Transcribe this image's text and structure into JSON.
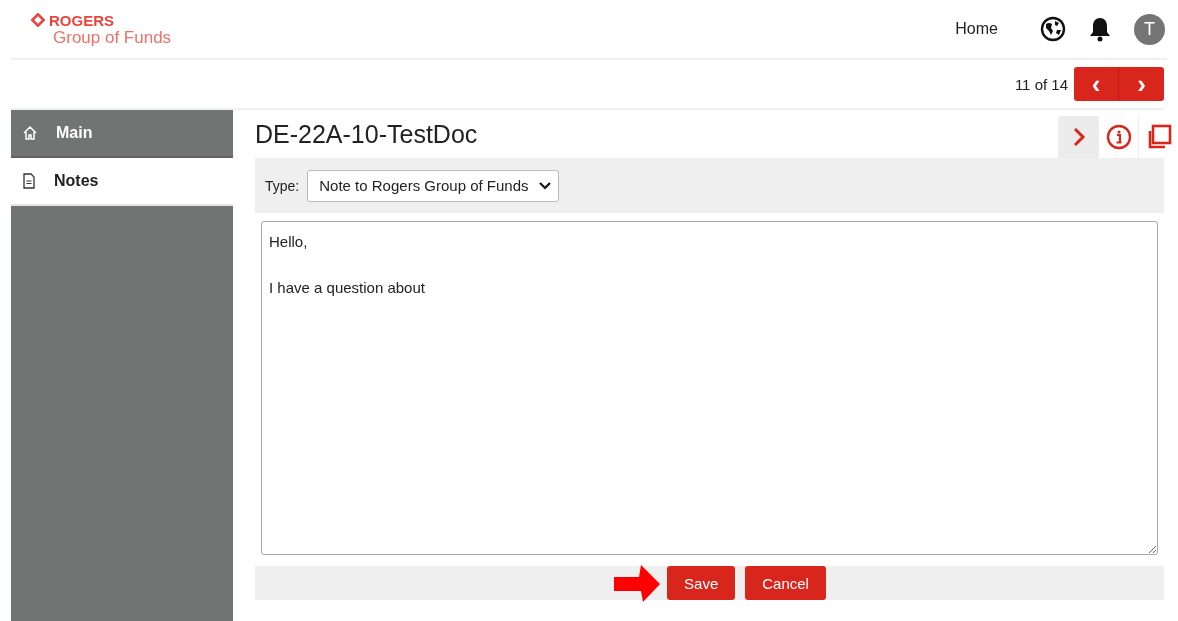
{
  "header": {
    "brand": "ROGERS",
    "brand_sub": "Group of Funds",
    "nav": [
      "Home"
    ],
    "avatar": "T"
  },
  "pager": {
    "text": "11 of 14",
    "prev": "‹",
    "next": "›"
  },
  "sidebar": {
    "items": [
      {
        "label": "Main",
        "kind": "home",
        "selected": false
      },
      {
        "label": "Notes",
        "kind": "doc",
        "selected": true
      }
    ]
  },
  "document": {
    "title": "DE-22A-10-TestDoc",
    "type_label": "Type:",
    "type_value": "Note to Rogers Group of Funds",
    "note": "Hello,\n\nI have a question about"
  },
  "buttons": [
    "Save",
    "Cancel"
  ]
}
